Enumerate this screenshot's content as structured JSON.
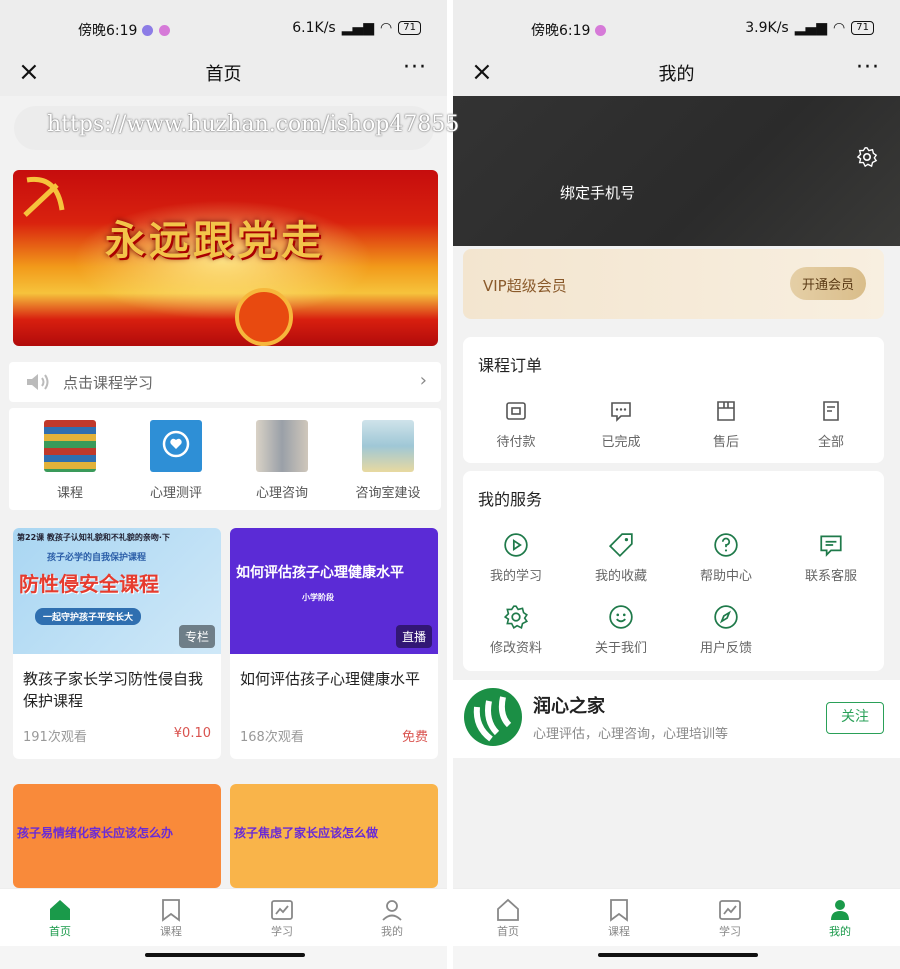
{
  "left": {
    "status": {
      "time": "傍晚6:19",
      "speed": "6.1K/s",
      "battery": "71"
    },
    "nav": {
      "title": "首页",
      "close": "×",
      "more": "···"
    },
    "watermark": "https://www.huzhan.com/ishop47855",
    "banner": {
      "slogan": "永远跟党走"
    },
    "notice": {
      "text": "点击课程学习",
      "arrow": "›"
    },
    "categories": [
      {
        "label": "课程",
        "icon": "books-icon"
      },
      {
        "label": "心理测评",
        "icon": "head-heart-icon"
      },
      {
        "label": "心理咨询",
        "icon": "consult-photo-icon"
      },
      {
        "label": "咨询室建设",
        "icon": "room-photo-icon"
      }
    ],
    "cards": [
      {
        "cover_text": "防性侵安全课程",
        "cover_top": "第22课 教孩子认知礼貌和不礼貌的亲吻·下",
        "cover_sub": "孩子必学的自我保护课程",
        "cover_btn": "一起守护孩子平安长大",
        "badge": "专栏",
        "title": "教孩子家长学习防性侵自我保护课程",
        "views": "191次观看",
        "price": "¥0.10"
      },
      {
        "cover_text": "如何评估孩子心理健康水平",
        "cover_sub": "小学阶段",
        "badge": "直播",
        "title": "如何评估孩子心理健康水平",
        "views": "168次观看",
        "price": "免费"
      },
      {
        "cover_text": "孩子易情绪化家长应该怎么办"
      },
      {
        "cover_text": "孩子焦虑了家长应该怎么做"
      }
    ],
    "tabs": [
      {
        "label": "首页",
        "active": true
      },
      {
        "label": "课程",
        "active": false
      },
      {
        "label": "学习",
        "active": false
      },
      {
        "label": "我的",
        "active": false
      }
    ]
  },
  "right": {
    "status": {
      "time": "傍晚6:19",
      "speed": "3.9K/s",
      "battery": "71"
    },
    "nav": {
      "title": "我的",
      "close": "×",
      "more": "···"
    },
    "bind_phone": "绑定手机号",
    "vip": {
      "label": "VIP超级会员",
      "button": "开通会员"
    },
    "orders": {
      "title": "课程订单",
      "items": [
        {
          "label": "待付款",
          "icon": "wallet-icon"
        },
        {
          "label": "已完成",
          "icon": "chat-dots-icon"
        },
        {
          "label": "售后",
          "icon": "store-icon"
        },
        {
          "label": "全部",
          "icon": "document-icon"
        }
      ]
    },
    "services": {
      "title": "我的服务",
      "items": [
        {
          "label": "我的学习",
          "icon": "play-circle-icon"
        },
        {
          "label": "我的收藏",
          "icon": "tag-icon"
        },
        {
          "label": "帮助中心",
          "icon": "question-icon"
        },
        {
          "label": "联系客服",
          "icon": "message-icon"
        },
        {
          "label": "修改资料",
          "icon": "gear-icon"
        },
        {
          "label": "关于我们",
          "icon": "smile-icon"
        },
        {
          "label": "用户反馈",
          "icon": "compass-icon"
        }
      ]
    },
    "brand": {
      "name": "润心之家",
      "desc": "心理评估，心理咨询，心理培训等",
      "follow": "关注"
    },
    "tabs": [
      {
        "label": "首页",
        "active": false
      },
      {
        "label": "课程",
        "active": false
      },
      {
        "label": "学习",
        "active": false
      },
      {
        "label": "我的",
        "active": true
      }
    ]
  },
  "colors": {
    "accent": "#1a9a4a",
    "price": "#d9534f",
    "vip_text": "#8a5a2b"
  }
}
